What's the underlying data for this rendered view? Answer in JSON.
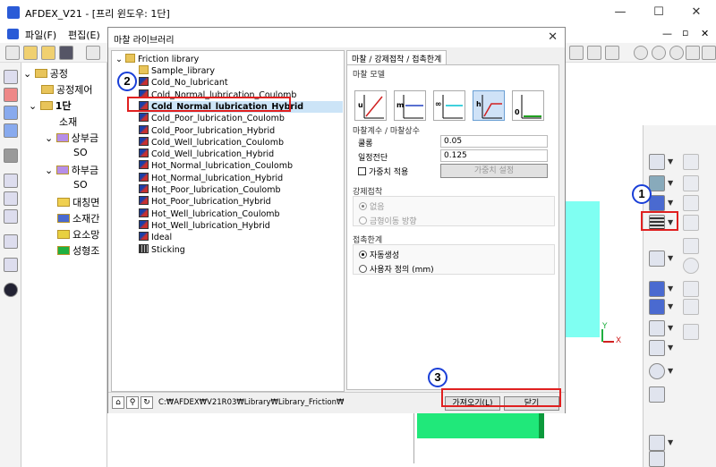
{
  "app": {
    "title": "AFDEX_V21 - [프리 윈도우: 1단]",
    "window_controls": [
      "—",
      "☐",
      "✕"
    ],
    "inner_controls": [
      "—",
      "▫",
      "✕"
    ]
  },
  "menu": [
    "파일(F)",
    "편집(E)"
  ],
  "tree": {
    "items": [
      {
        "label": "공정"
      },
      {
        "label": "공정제어"
      },
      {
        "label": "1단"
      },
      {
        "label": "소재"
      },
      {
        "label": "상부금"
      },
      {
        "label": "SO"
      },
      {
        "label": "하부금"
      },
      {
        "label": "SO"
      },
      {
        "label": "대칭면"
      },
      {
        "label": "소재간"
      },
      {
        "label": "요소망"
      },
      {
        "label": "성형조"
      }
    ]
  },
  "dialog": {
    "title": "마찰 라이브러리",
    "close_glyph": "✕",
    "library": {
      "root": "Friction library",
      "items": [
        {
          "label": "Sample_library",
          "icon": "folder"
        },
        {
          "label": "Cold_No_lubricant",
          "icon": "friction"
        },
        {
          "label": "Cold_Normal_lubrication_Coulomb",
          "icon": "friction"
        },
        {
          "label": "Cold_Normal_lubrication_Hybrid",
          "icon": "friction",
          "selected": true
        },
        {
          "label": "Cold_Poor_lubrication_Coulomb",
          "icon": "friction"
        },
        {
          "label": "Cold_Poor_lubrication_Hybrid",
          "icon": "friction"
        },
        {
          "label": "Cold_Well_lubrication_Coulomb",
          "icon": "friction"
        },
        {
          "label": "Cold_Well_lubrication_Hybrid",
          "icon": "friction"
        },
        {
          "label": "Hot_Normal_lubrication_Coulomb",
          "icon": "friction"
        },
        {
          "label": "Hot_Normal_lubrication_Hybrid",
          "icon": "friction"
        },
        {
          "label": "Hot_Poor_lubrication_Coulomb",
          "icon": "friction"
        },
        {
          "label": "Hot_Poor_lubrication_Hybrid",
          "icon": "friction"
        },
        {
          "label": "Hot_Well_lubrication_Coulomb",
          "icon": "friction"
        },
        {
          "label": "Hot_Well_lubrication_Hybrid",
          "icon": "friction"
        },
        {
          "label": "Ideal",
          "icon": "friction"
        },
        {
          "label": "Sticking",
          "icon": "sticking"
        }
      ]
    },
    "tab_label": "마찰 / 강제접착 / 접촉한계",
    "friction_model": {
      "label": "마찰 모델",
      "buttons": [
        {
          "name": "coulomb",
          "glyph": "u",
          "active": false
        },
        {
          "name": "shear",
          "glyph": "m",
          "active": false
        },
        {
          "name": "infinite",
          "glyph": "∞",
          "active": false
        },
        {
          "name": "hybrid",
          "glyph": "h",
          "active": true
        },
        {
          "name": "zero",
          "glyph": "0",
          "active": false
        }
      ]
    },
    "coefficients": {
      "label": "마찰계수 / 마찰상수",
      "coulomb_label": "쿨롱",
      "coulomb_value": "0.05",
      "shear_label": "일정전단",
      "shear_value": "0.125",
      "weight_checkbox": "가중치 적용",
      "weight_button": "가중치 설정"
    },
    "forced_contact": {
      "label": "강제접착",
      "option_none": "없음",
      "option_velocity": "금형이동 방향"
    },
    "contact_limit": {
      "label": "접촉한계",
      "option_auto": "자동생성",
      "option_user": "사용자 정의 (mm)"
    },
    "path": "C:₩AFDEX₩V21R03₩Library₩Library_Friction₩",
    "import_button": "가져오기(L)",
    "close_button": "닫기"
  },
  "viewport": {
    "axis_x": "X",
    "axis_y": "Y",
    "part_colors": {
      "upper": "#7ffff2",
      "lower": "#20e87a",
      "lower_edge": "#0c9a3c"
    }
  },
  "callouts": [
    "1",
    "2",
    "3"
  ],
  "accent": {
    "highlight": "#e02020",
    "callout_ring": "#1a3fd7",
    "selection": "#cce4f7"
  }
}
